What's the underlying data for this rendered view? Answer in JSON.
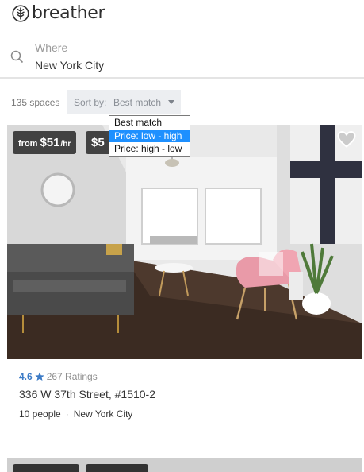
{
  "brand": {
    "name": "breather"
  },
  "search": {
    "label": "Where",
    "value": "New York City"
  },
  "results": {
    "count_text": "135 spaces"
  },
  "sort": {
    "prefix": "Sort by:",
    "selected": "Best match",
    "options": [
      "Best match",
      "Price: low - high",
      "Price: high - low"
    ],
    "highlighted_option": "Price: low - high"
  },
  "listing": {
    "price_from_prefix": "from",
    "price_from": "$51",
    "price_unit": "/hr",
    "price_second": "$5",
    "rating": "4.6",
    "ratings_count": "267 Ratings",
    "address": "336 W 37th Street, #1510-2",
    "capacity": "10 people",
    "city": "New York City"
  },
  "colors": {
    "accent": "#3c7bc6",
    "highlight": "#1e90ff",
    "sort_bg": "#eceef1"
  },
  "icons": {
    "logo": "tree-logo-icon",
    "search": "search-icon",
    "heart": "heart-icon",
    "star": "star-icon",
    "caret": "caret-down-icon"
  }
}
